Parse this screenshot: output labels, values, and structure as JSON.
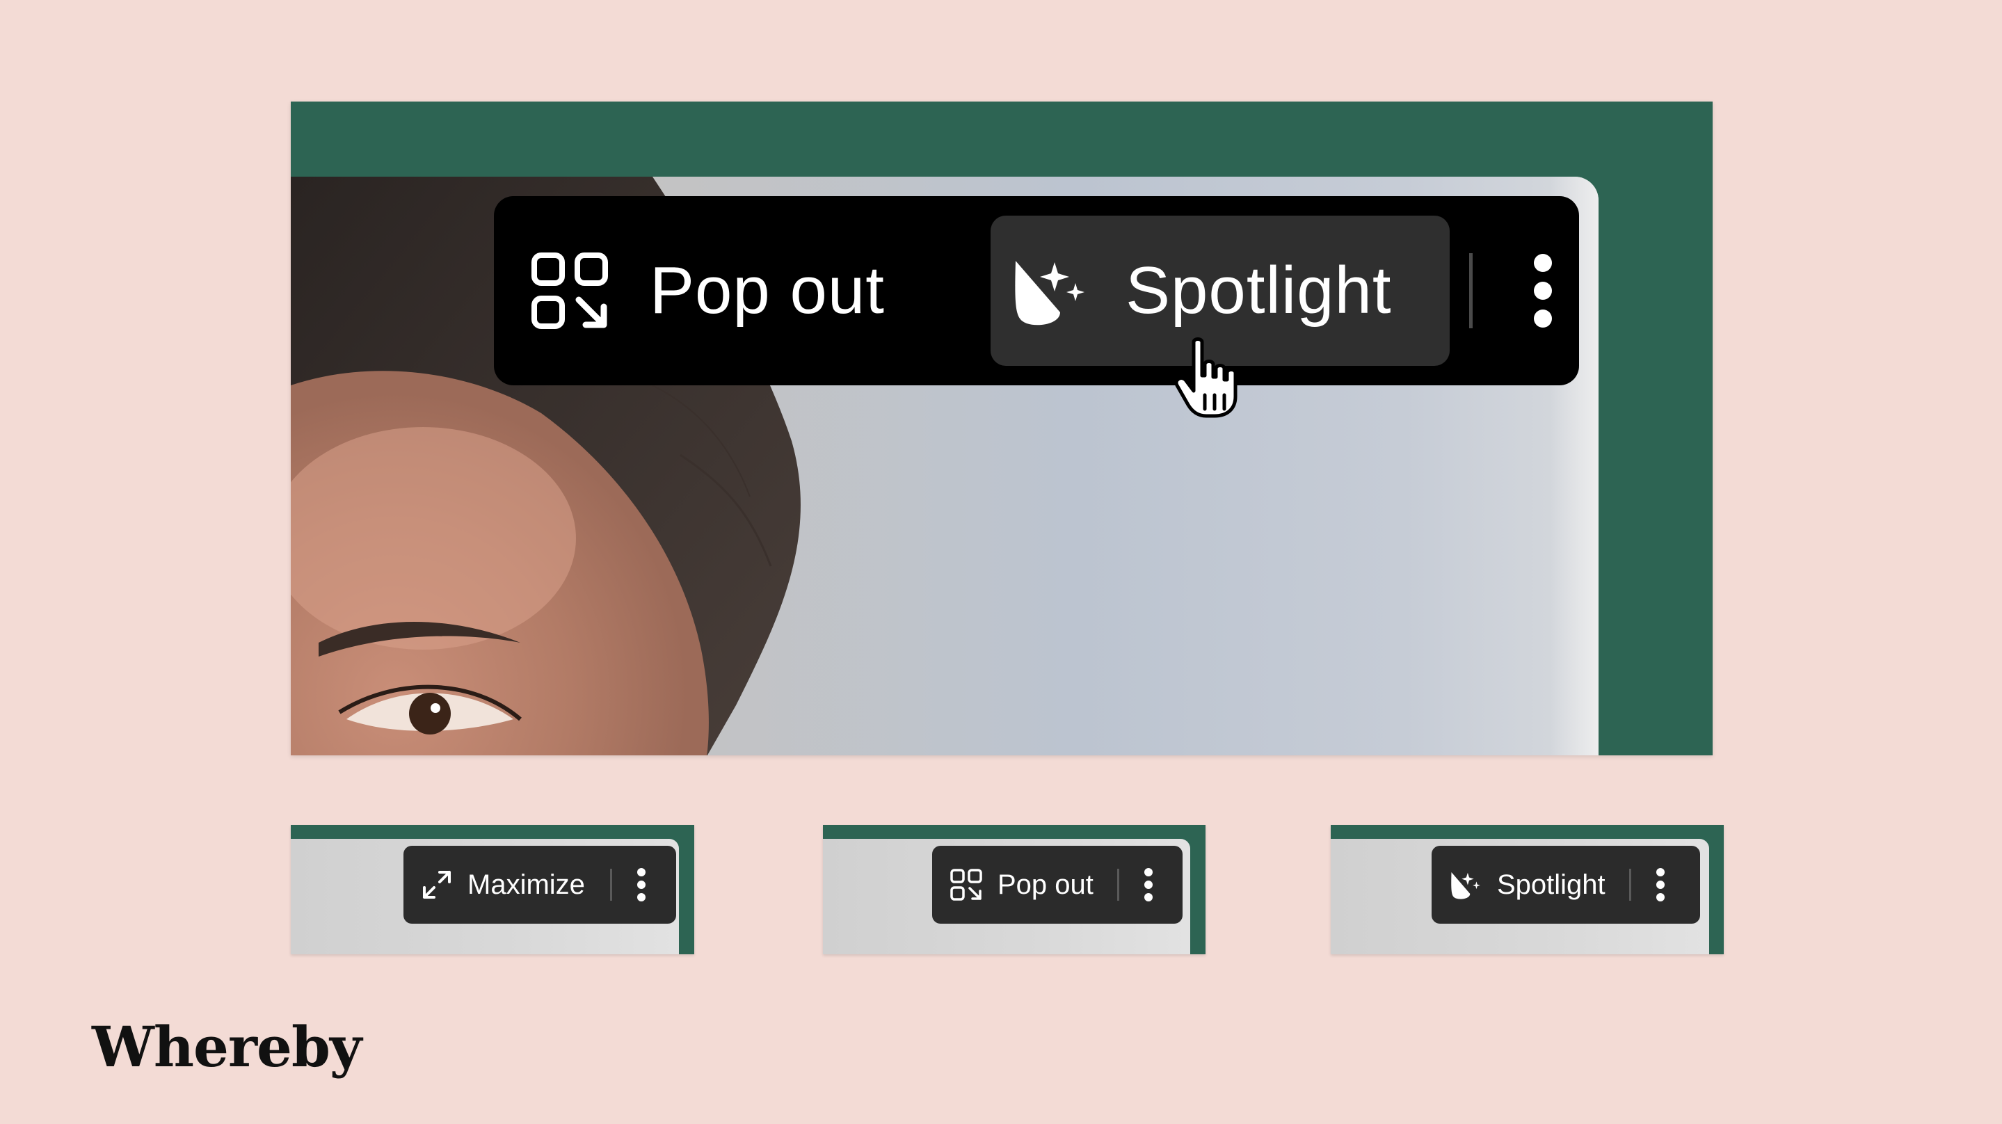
{
  "hero": {
    "popout_label": "Pop out",
    "spotlight_label": "Spotlight",
    "more_icon": "vertical-ellipsis-icon"
  },
  "cards": {
    "maximize": {
      "label": "Maximize",
      "icon": "maximize-arrows-icon"
    },
    "popout": {
      "label": "Pop out",
      "icon": "popout-grid-icon"
    },
    "spotlight": {
      "label": "Spotlight",
      "icon": "spotlight-icon"
    }
  },
  "brand": {
    "logo_text": "Whereby"
  },
  "colors": {
    "background": "#f3dbd5",
    "tile_frame": "#2d6453",
    "toolbar": "#000000",
    "toolbar_active": "#2f2f2f"
  }
}
